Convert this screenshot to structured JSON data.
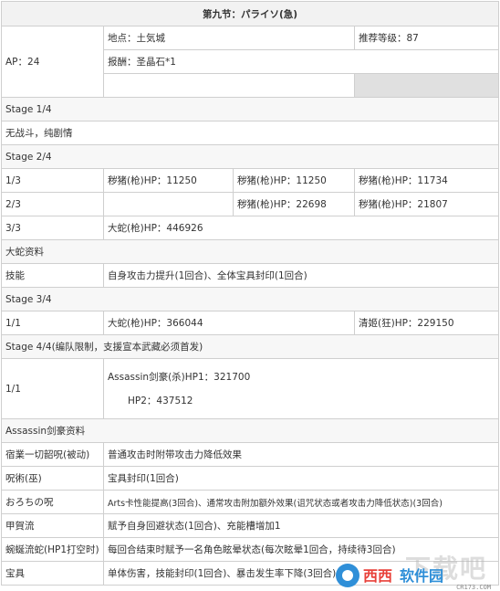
{
  "title": "第九节：パライソ(急)",
  "info": {
    "ap": "AP：24",
    "location": "地点：土気城",
    "recommend": "推荐等级：87",
    "reward": "报酬：圣晶石*1"
  },
  "stage1": {
    "label": "Stage 1/4",
    "note": "无战斗，纯剧情"
  },
  "stage2": {
    "label": "Stage 2/4",
    "waves": [
      {
        "wave": "1/3",
        "enemies": [
          "秽猪(枪)HP：11250",
          "秽猪(枪)HP：11250",
          "秽猪(枪)HP：11734"
        ]
      },
      {
        "wave": "2/3",
        "enemies": [
          "",
          "秽猪(枪)HP：22698",
          "秽猪(枪)HP：21807"
        ]
      },
      {
        "wave": "3/3",
        "enemies": [
          "大蛇(枪)HP：446926",
          "",
          ""
        ]
      }
    ]
  },
  "snake_info": {
    "label": "大蛇资料",
    "skill_key": "技能",
    "skill_value": "自身攻击力提升(1回合)、全体宝具封印(1回合)"
  },
  "stage3": {
    "label": "Stage 3/4",
    "wave": "1/1",
    "enemy1": "大蛇(枪)HP：366044",
    "enemy2": "清姬(狂)HP：229150"
  },
  "stage4": {
    "label": "Stage 4/4(编队限制，支援宣本武藏必须首发)",
    "wave": "1/1",
    "hp1": "Assassin剑豪(杀)HP1：321700",
    "hp2": "HP2：437512"
  },
  "assassin_info": {
    "label": "Assassin剑豪资料",
    "rows": [
      {
        "key": "宿業一切韶呪(被动)",
        "value": "普通攻击时附带攻击力降低效果"
      },
      {
        "key": "呪術(巫)",
        "value": "宝具封印(1回合)"
      },
      {
        "key": "おろちの呪",
        "value": "Arts卡性能提高(3回合)、通常攻击附加额外效果(诅咒状态或者攻击力降低状态)(3回合)"
      },
      {
        "key": "甲賀流",
        "value": "赋予自身回避状态(1回合)、充能槽增加1"
      },
      {
        "key": "蜿蜒流蛇(HP1打空时)",
        "value": "每回合结束时赋予一名角色眩晕状态(每次眩晕1回合，持续待3回合)"
      },
      {
        "key": "宝具",
        "value": "单体伤害，技能封印(1回合)、暴击发生率下降(3回合)"
      }
    ]
  },
  "watermark": {
    "big": "下载吧",
    "text1": "西西",
    "text2": "软件园",
    "url": "CR173.COM"
  },
  "colors": {
    "header_bg": "#f2f2f2",
    "border": "#cfcfcf",
    "gray_cell": "#e0e0e0",
    "text": "#333333"
  }
}
